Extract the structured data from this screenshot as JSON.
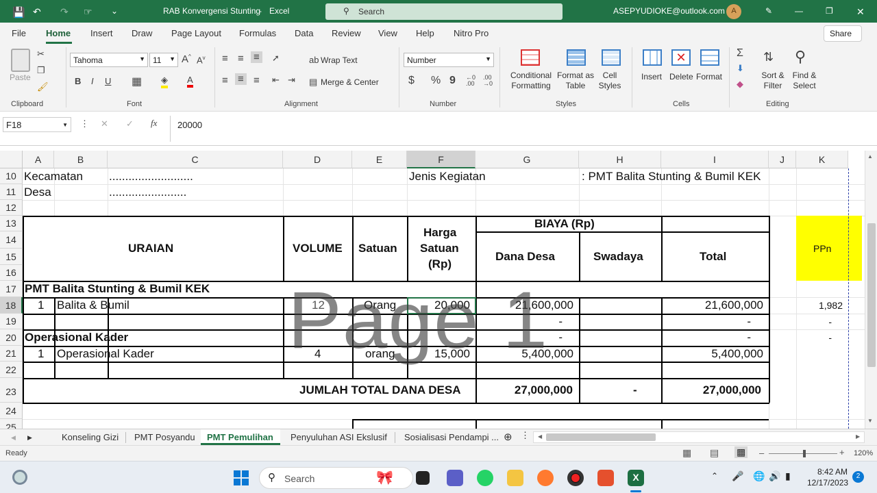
{
  "titlebar": {
    "file_title": "RAB Konvergensi Stunting",
    "app": "Excel",
    "search_placeholder": "Search",
    "account": "ASEPYUDIOKE@outlook.com",
    "avatar_initial": "A"
  },
  "ribbon_tabs": [
    "File",
    "Home",
    "Insert",
    "Draw",
    "Page Layout",
    "Formulas",
    "Data",
    "Review",
    "View",
    "Help",
    "Nitro Pro"
  ],
  "share_label": "Share",
  "ribbon": {
    "clipboard": {
      "paste": "Paste",
      "group": "Clipboard"
    },
    "font": {
      "name": "Tahoma",
      "size": "11",
      "group": "Font",
      "bold": "B",
      "italic": "I",
      "underline": "U"
    },
    "alignment": {
      "wrap": "Wrap Text",
      "merge": "Merge & Center",
      "group": "Alignment"
    },
    "number": {
      "format": "Number",
      "group": "Number",
      "currency": "$",
      "percent": "%",
      "comma": "9"
    },
    "styles": {
      "conditional": "Conditional Formatting",
      "format_table": "Format as Table",
      "cell_styles": "Cell Styles",
      "group": "Styles"
    },
    "cells": {
      "insert": "Insert",
      "delete": "Delete",
      "format": "Format",
      "group": "Cells"
    },
    "editing": {
      "sort": "Sort & Filter",
      "find": "Find & Select",
      "group": "Editing"
    }
  },
  "formula_bar": {
    "name_box": "F18",
    "fx": "fx",
    "value": "20000"
  },
  "columns": [
    "A",
    "B",
    "C",
    "D",
    "E",
    "F",
    "G",
    "H",
    "I",
    "J",
    "K"
  ],
  "rows": [
    "10",
    "11",
    "12",
    "13",
    "14",
    "15",
    "16",
    "17",
    "18",
    "19",
    "20",
    "21",
    "22",
    "23",
    "24",
    "25"
  ],
  "sheet": {
    "r10": {
      "a": "Kecamatan",
      "c": "..........................",
      "f": "Jenis Kegiatan",
      "h": ": PMT Balita Stunting & Bumil KEK"
    },
    "r11": {
      "a": "Desa",
      "c": "........................"
    },
    "header": {
      "uraian": "URAIAN",
      "volume": "VOLUME",
      "satuan": "Satuan",
      "harga1": "Harga",
      "harga2": "Satuan",
      "harga3": "(Rp)",
      "biaya": "BIAYA (Rp)",
      "dana_desa": "Dana Desa",
      "swadaya": "Swadaya",
      "total": "Total",
      "ppn": "PPn"
    },
    "r17": {
      "a": "PMT Balita Stunting & Bumil KEK"
    },
    "r18": {
      "no": "1",
      "b": "Balita & Bumil",
      "vol": "12",
      "sat": "Orang",
      "harga": "20,000",
      "dana": "21,600,000",
      "total": "21,600,000",
      "k": "1,982"
    },
    "r19": {
      "dana": "-",
      "total": "-",
      "k": "-"
    },
    "r20": {
      "a": "Operasional Kader",
      "dana": "-",
      "total": "-",
      "k": "-"
    },
    "r21": {
      "no": "1",
      "b": "Operasional Kader",
      "vol": "4",
      "sat": "orang",
      "harga": "15,000",
      "dana": "5,400,000",
      "total": "5,400,000"
    },
    "r23": {
      "label": "JUMLAH TOTAL DANA DESA",
      "dana": "27,000,000",
      "swadaya": "-",
      "total": "27,000,000"
    }
  },
  "watermark": "Page 1",
  "sheet_tabs": [
    "Konseling Gizi",
    "PMT Posyandu",
    "PMT Pemulihan",
    "Penyuluhan ASI Ekslusif",
    "Sosialisasi Pendampi ..."
  ],
  "active_tab": "PMT Pemulihan",
  "status": {
    "ready": "Ready",
    "zoom": "120%"
  },
  "taskbar": {
    "search": "Search",
    "time": "8:42 AM",
    "date": "12/17/2023",
    "badge": "2"
  },
  "colors": {
    "excel_green": "#217346",
    "ppn_fill": "#ffff00"
  }
}
